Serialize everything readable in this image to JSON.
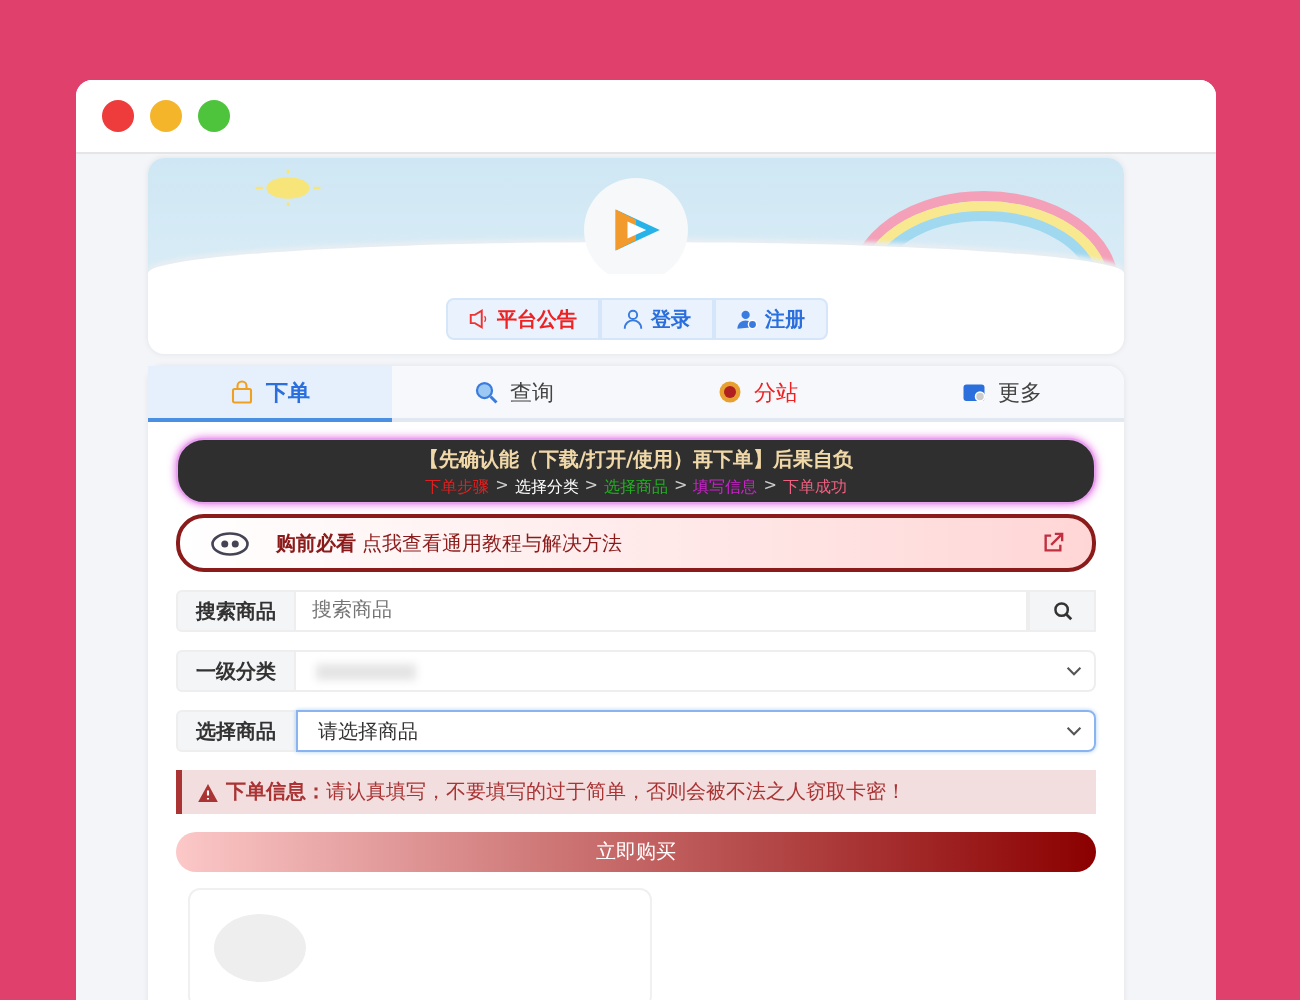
{
  "header": {
    "buttons": [
      {
        "label": "平台公告",
        "kind": "notice"
      },
      {
        "label": "登录",
        "kind": "login"
      },
      {
        "label": "注册",
        "kind": "register"
      }
    ]
  },
  "tabs": [
    {
      "label": "下单",
      "selected": true,
      "kind": "bag"
    },
    {
      "label": "查询",
      "selected": false,
      "kind": "search"
    },
    {
      "label": "分站",
      "selected": false,
      "kind": "coin"
    },
    {
      "label": "更多",
      "selected": false,
      "kind": "wallet"
    }
  ],
  "banner": {
    "title": "【先确认能（下载/打开/使用）再下单】后果自负",
    "steps": [
      {
        "label": "下单步骤",
        "color": "#e02020"
      },
      {
        "label": "选择分类",
        "color": "#ffffff"
      },
      {
        "label": "选择商品",
        "color": "#20b020"
      },
      {
        "label": "填写信息",
        "color": "#d020d0"
      },
      {
        "label": "下单成功",
        "color": "#f06080"
      }
    ],
    "separator": ">"
  },
  "guide": {
    "bold": "购前必看",
    "text": "点我查看通用教程与解决方法"
  },
  "form": [
    {
      "kind": "search",
      "label": "搜索商品",
      "placeholder": "搜索商品",
      "focused": false
    },
    {
      "kind": "select",
      "label": "一级分类",
      "blurred": true,
      "focused": false
    },
    {
      "kind": "select",
      "label": "选择商品",
      "value": "请选择商品",
      "focused": true
    }
  ],
  "alert": {
    "title": "下单信息：",
    "text": "请认真填写，不要填写的过于简单，否则会被不法之人窃取卡密！"
  },
  "buy_button": "立即购买"
}
